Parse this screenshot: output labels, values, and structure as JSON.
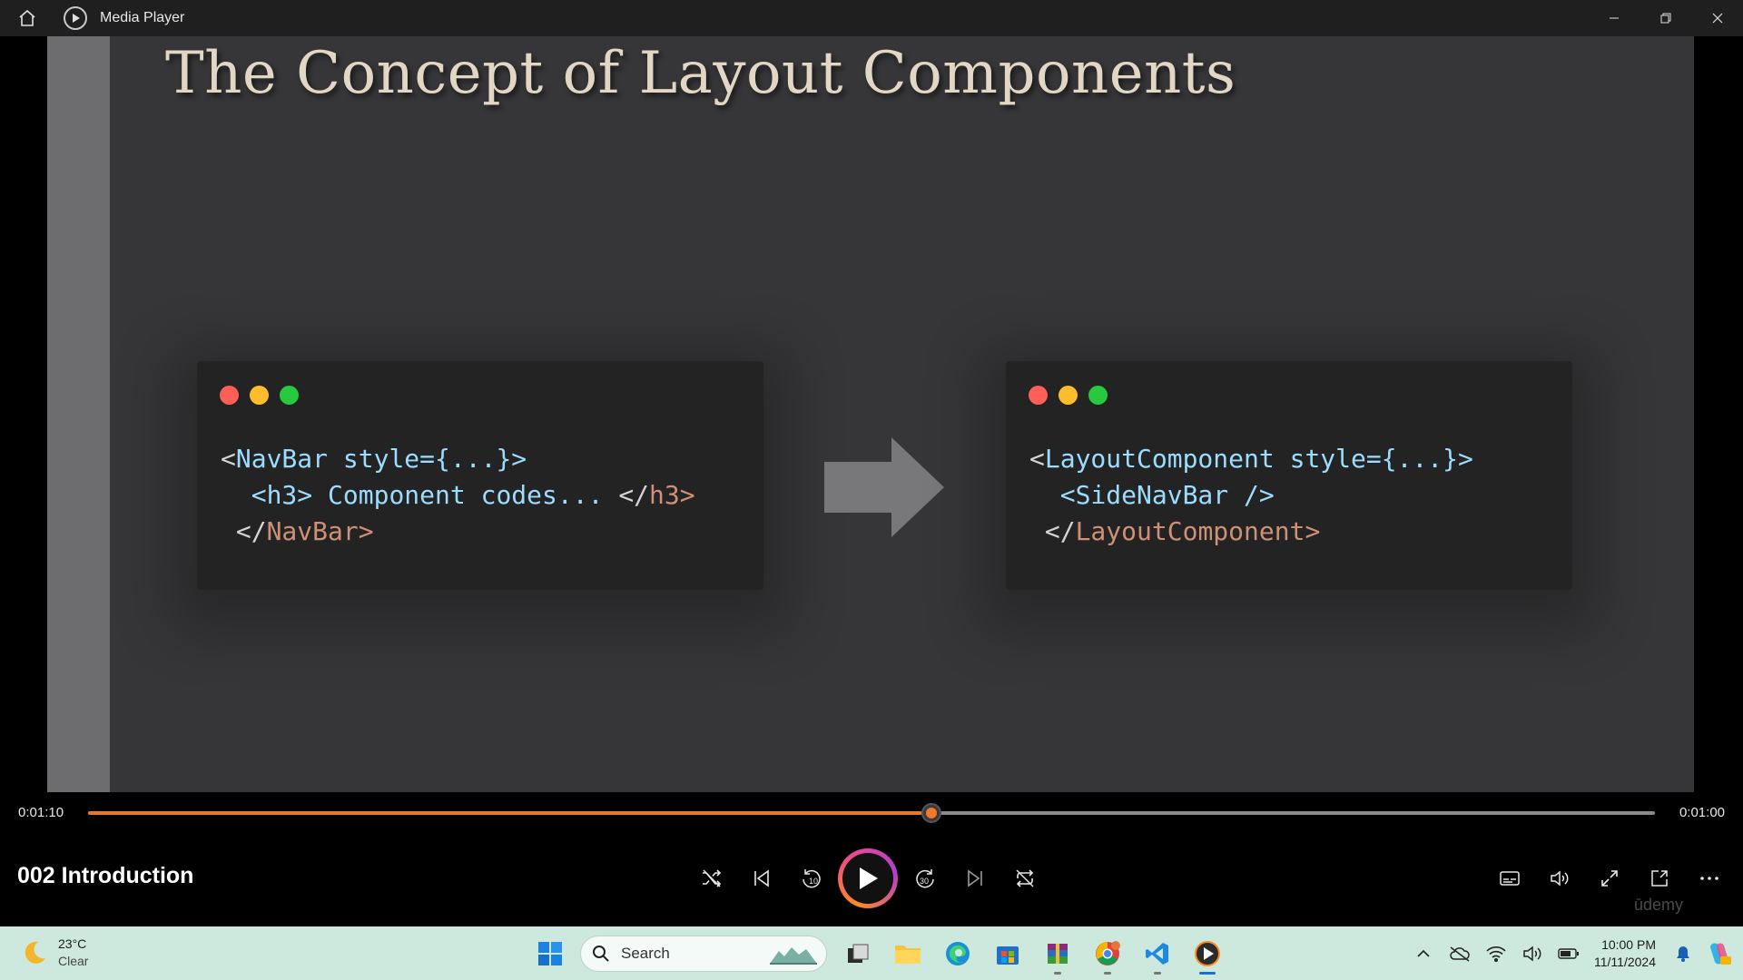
{
  "window": {
    "title": "Media Player"
  },
  "slide": {
    "title": "The Concept of Layout Components",
    "left_code": [
      [
        {
          "t": "<",
          "c": "punct"
        },
        {
          "t": "NavBar",
          "c": "blue"
        },
        {
          "t": " style={...}>",
          "c": "blue"
        }
      ],
      [
        {
          "t": "  <h3> ",
          "c": "blue"
        },
        {
          "t": "Component codes... ",
          "c": "blue"
        },
        {
          "t": "</",
          "c": "punct"
        },
        {
          "t": "h3>",
          "c": "orange"
        }
      ],
      [
        {
          "t": " </",
          "c": "punct"
        },
        {
          "t": "NavBar>",
          "c": "orange"
        }
      ]
    ],
    "right_code": [
      [
        {
          "t": "<",
          "c": "punct"
        },
        {
          "t": "LayoutComponent",
          "c": "blue"
        },
        {
          "t": " style={...}>",
          "c": "blue"
        }
      ],
      [
        {
          "t": "  <SideNavBar />",
          "c": "blue"
        }
      ],
      [
        {
          "t": " </",
          "c": "punct"
        },
        {
          "t": "LayoutComponent>",
          "c": "orange"
        }
      ]
    ],
    "dot_colors": [
      "#ff5f56",
      "#ffbd2e",
      "#27c93f"
    ]
  },
  "playback": {
    "elapsed": "0:01:10",
    "remaining": "0:01:00",
    "progress_fraction": 0.5383,
    "accent_color": "#e8762b"
  },
  "media": {
    "title": "002 Introduction"
  },
  "watermark": "ūdemy",
  "taskbar": {
    "weather": {
      "temp": "23°C",
      "condition": "Clear"
    },
    "search": {
      "placeholder": "Search"
    },
    "clock": {
      "time": "10:00 PM",
      "date": "11/11/2024"
    }
  }
}
